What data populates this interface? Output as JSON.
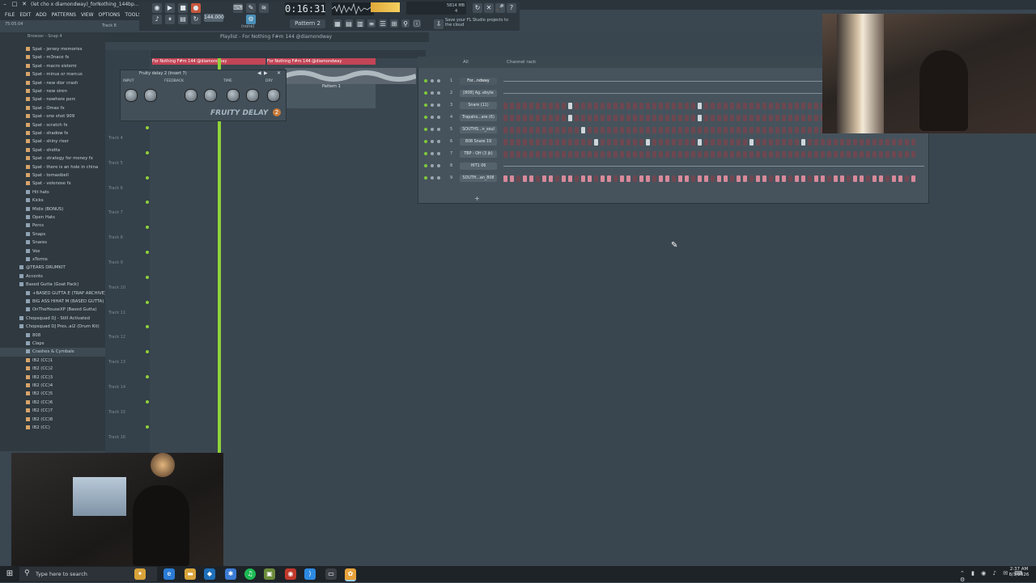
{
  "window": {
    "title": "(let cho x diamondway)_forNothing_144bp..."
  },
  "menu": [
    "FILE",
    "EDIT",
    "ADD",
    "PATTERNS",
    "VIEW",
    "OPTIONS",
    "TOOLS",
    "?"
  ],
  "transport": {
    "time": "0:16:31",
    "pattern": "Pattern 2",
    "tempo": "144.000",
    "none_label": "(none)",
    "cpu": "5814 MB",
    "cpu_sub": "4",
    "cloud_tip": "Save your FL Studio projects to the cloud",
    "counter": "75:05:04",
    "track_label": "Track 8"
  },
  "browser": {
    "header": "Browser - Snap 4",
    "items": [
      {
        "label": "Spat - jersey memories",
        "type": "file"
      },
      {
        "label": "Spat - m3nace fx",
        "type": "file"
      },
      {
        "label": "Spat - macro sistemi",
        "type": "file"
      },
      {
        "label": "Spat - minus or marcus",
        "type": "file"
      },
      {
        "label": "Spat - new dior crash",
        "type": "file"
      },
      {
        "label": "Spat - new siren",
        "type": "file"
      },
      {
        "label": "Spat - nowhere perc",
        "type": "file"
      },
      {
        "label": "Spat - Omax fx",
        "type": "file"
      },
      {
        "label": "Spat - one shot 909",
        "type": "file"
      },
      {
        "label": "Spat - scratch fx",
        "type": "file"
      },
      {
        "label": "Spat - shadow fx",
        "type": "file"
      },
      {
        "label": "Spat - shiny riser",
        "type": "file"
      },
      {
        "label": "Spat - shotta",
        "type": "file"
      },
      {
        "label": "Spat - strategy for money fx",
        "type": "file"
      },
      {
        "label": "Spat - there is an hole in china",
        "type": "file"
      },
      {
        "label": "Spat - tomasibell",
        "type": "file"
      },
      {
        "label": "Spat - velenose fx",
        "type": "file"
      },
      {
        "label": "Hit hats",
        "type": "folder"
      },
      {
        "label": "Kicks",
        "type": "folder"
      },
      {
        "label": "Midis (BONUS)",
        "type": "folder"
      },
      {
        "label": "Open Hats",
        "type": "folder"
      },
      {
        "label": "Percs",
        "type": "folder"
      },
      {
        "label": "Snaps",
        "type": "folder"
      },
      {
        "label": "Snares",
        "type": "folder"
      },
      {
        "label": "Vox",
        "type": "folder"
      },
      {
        "label": "xTerms",
        "type": "folder"
      },
      {
        "label": "@TEARS DRUMKIT",
        "type": "folder"
      },
      {
        "label": "Accents",
        "type": "folder"
      },
      {
        "label": "Based Gutta (Goat Pack)",
        "type": "folder"
      },
      {
        "label": "+BASED GUTTA E (TRAP ARCHIVE)",
        "type": "folder"
      },
      {
        "label": "BIG ASS HIHAT M (BASED GUTTA)",
        "type": "folder"
      },
      {
        "label": "OnTheHouseXP (Based Gutta)",
        "type": "folder"
      },
      {
        "label": "Chopsquad DJ - Still Activated",
        "type": "folder"
      },
      {
        "label": "Chopsquad DJ Pres..al2 (Drum Kit)",
        "type": "folder"
      },
      {
        "label": "808",
        "type": "folder"
      },
      {
        "label": "Claps",
        "type": "folder"
      },
      {
        "label": "Crashes & Cymbals",
        "type": "folder"
      },
      {
        "label": "IB2 (CC)1",
        "type": "file"
      },
      {
        "label": "IB2 (CC)2",
        "type": "file"
      },
      {
        "label": "IB2 (CC)3",
        "type": "file"
      },
      {
        "label": "IB2 (CC)4",
        "type": "file"
      },
      {
        "label": "IB2 (CC)5",
        "type": "file"
      },
      {
        "label": "IB2 (CC)6",
        "type": "file"
      },
      {
        "label": "IB2 (CC)7",
        "type": "file"
      },
      {
        "label": "IB2 (CC)8",
        "type": "file"
      },
      {
        "label": "IB2 (CC)",
        "type": "file"
      }
    ]
  },
  "playlist": {
    "title": "Playlist - For Nothing F#m 144 @diamondway",
    "clip1": "For Nothing F#m 144 @diamondway",
    "clip2": "For Nothing F#m 144 @diamondway",
    "pattern_clip": "Pattern 1",
    "tracks": [
      "Track 4",
      "Track 5",
      "Track 6",
      "Track 7",
      "Track 8",
      "Track 9",
      "Track 10",
      "Track 11",
      "Track 12",
      "Track 13",
      "Track 14",
      "Track 15",
      "Track 16"
    ]
  },
  "delay": {
    "title": "Fruity delay 2 (Insert 7)",
    "logo": "FRUITY DELAY",
    "badge": "2",
    "sections": [
      "INPUT",
      "FEEDBACK",
      "TIME",
      "DRY"
    ]
  },
  "rack": {
    "title": "Channel rack",
    "filter": "All",
    "channels": [
      {
        "num": "1",
        "name": "For...ndway",
        "mode": "audio"
      },
      {
        "num": "2",
        "name": "[808] Ag..ebyte",
        "mode": "piano"
      },
      {
        "num": "3",
        "name": "Snare (11)",
        "mode": "steps"
      },
      {
        "num": "4",
        "name": "Trapaho...are (6)",
        "mode": "steps"
      },
      {
        "num": "5",
        "name": "SOUTHS...n_soul",
        "mode": "steps"
      },
      {
        "num": "6",
        "name": "808 Snare 19",
        "mode": "steps"
      },
      {
        "num": "7",
        "name": "TBP - OH (3 jk)",
        "mode": "steps"
      },
      {
        "num": "8",
        "name": "HIT1 06",
        "mode": "piano"
      },
      {
        "num": "9",
        "name": "SOUTH...an_808",
        "mode": "pink"
      }
    ],
    "add_label": "+"
  },
  "taskbar": {
    "search_placeholder": "Type here to search",
    "time": "2:37 AM",
    "date": "8/3/2026"
  }
}
